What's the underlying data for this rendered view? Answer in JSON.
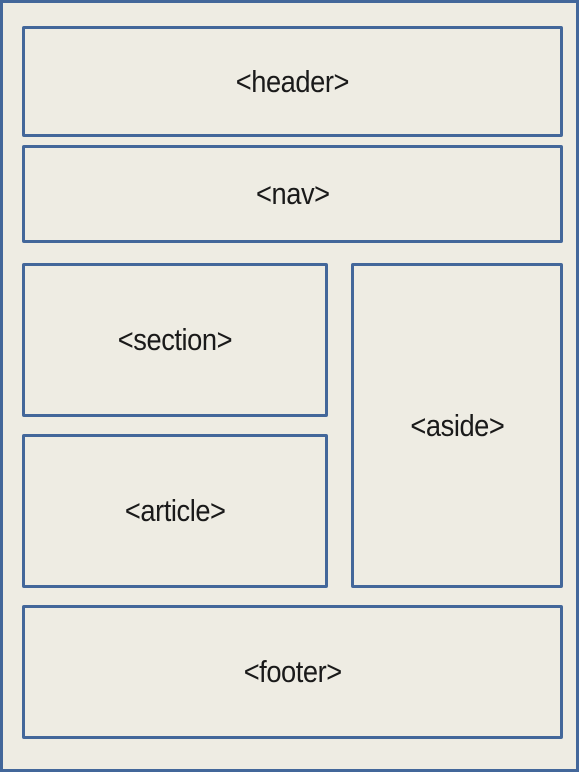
{
  "diagram": {
    "boxes": {
      "header": "<header>",
      "nav": "<nav>",
      "section": "<section>",
      "article": "<article>",
      "aside": "<aside>",
      "footer": "<footer>"
    }
  },
  "colors": {
    "border": "#43679a",
    "background": "#eeece3",
    "text": "#1a1a1a"
  }
}
